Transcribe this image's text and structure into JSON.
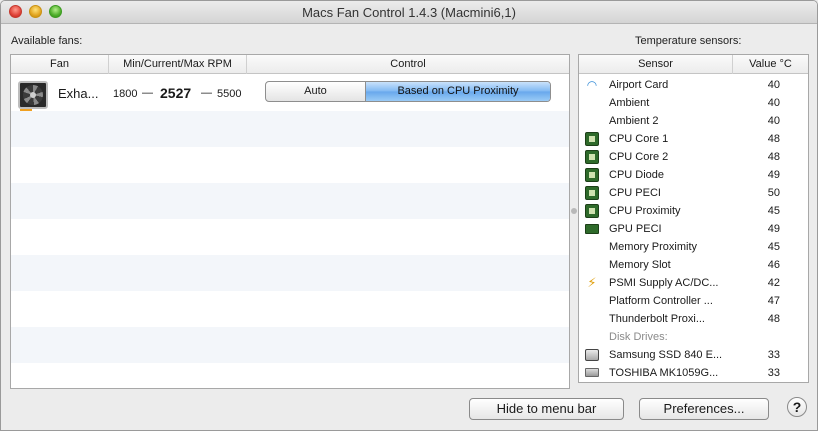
{
  "window": {
    "title": "Macs Fan Control 1.4.3 (Macmini6,1)"
  },
  "fans": {
    "label": "Available fans:",
    "headers": {
      "fan": "Fan",
      "rpm": "Min/Current/Max RPM",
      "control": "Control"
    },
    "items": [
      {
        "name": "Exha...",
        "min_rpm": "1800",
        "current_rpm": "2527",
        "max_rpm": "5500",
        "sep": "—",
        "control_options": [
          "Auto",
          "Based on CPU Proximity"
        ],
        "selected_control": "Based on CPU Proximity"
      }
    ]
  },
  "sensors": {
    "label": "Temperature sensors:",
    "headers": {
      "sensor": "Sensor",
      "value": "Value °C"
    },
    "items": [
      {
        "icon": "wifi-icon",
        "name": "Airport Card",
        "value": "40"
      },
      {
        "icon": "",
        "name": "Ambient",
        "value": "40"
      },
      {
        "icon": "",
        "name": "Ambient 2",
        "value": "40"
      },
      {
        "icon": "cpu-chip-icon",
        "name": "CPU Core 1",
        "value": "48"
      },
      {
        "icon": "cpu-chip-icon",
        "name": "CPU Core 2",
        "value": "48"
      },
      {
        "icon": "cpu-chip-icon",
        "name": "CPU Diode",
        "value": "49"
      },
      {
        "icon": "cpu-chip-icon",
        "name": "CPU PECI",
        "value": "50"
      },
      {
        "icon": "cpu-chip-icon",
        "name": "CPU Proximity",
        "value": "45"
      },
      {
        "icon": "gpu-card-icon",
        "name": "GPU PECI",
        "value": "49"
      },
      {
        "icon": "",
        "name": "Memory Proximity",
        "value": "45"
      },
      {
        "icon": "",
        "name": "Memory Slot",
        "value": "46"
      },
      {
        "icon": "power-bolt-icon",
        "name": "PSMI Supply AC/DC...",
        "value": "42"
      },
      {
        "icon": "",
        "name": "Platform Controller ...",
        "value": "47"
      },
      {
        "icon": "",
        "name": "Thunderbolt Proxi...",
        "value": "48"
      }
    ],
    "disk_group_label": "Disk Drives:",
    "disks": [
      {
        "icon": "ssd-drive-icon",
        "name": "Samsung SSD 840 E...",
        "value": "33"
      },
      {
        "icon": "hdd-drive-icon",
        "name": "TOSHIBA MK1059G...",
        "value": "33"
      }
    ]
  },
  "buttons": {
    "hide": "Hide to menu bar",
    "preferences": "Preferences...",
    "help": "?"
  }
}
